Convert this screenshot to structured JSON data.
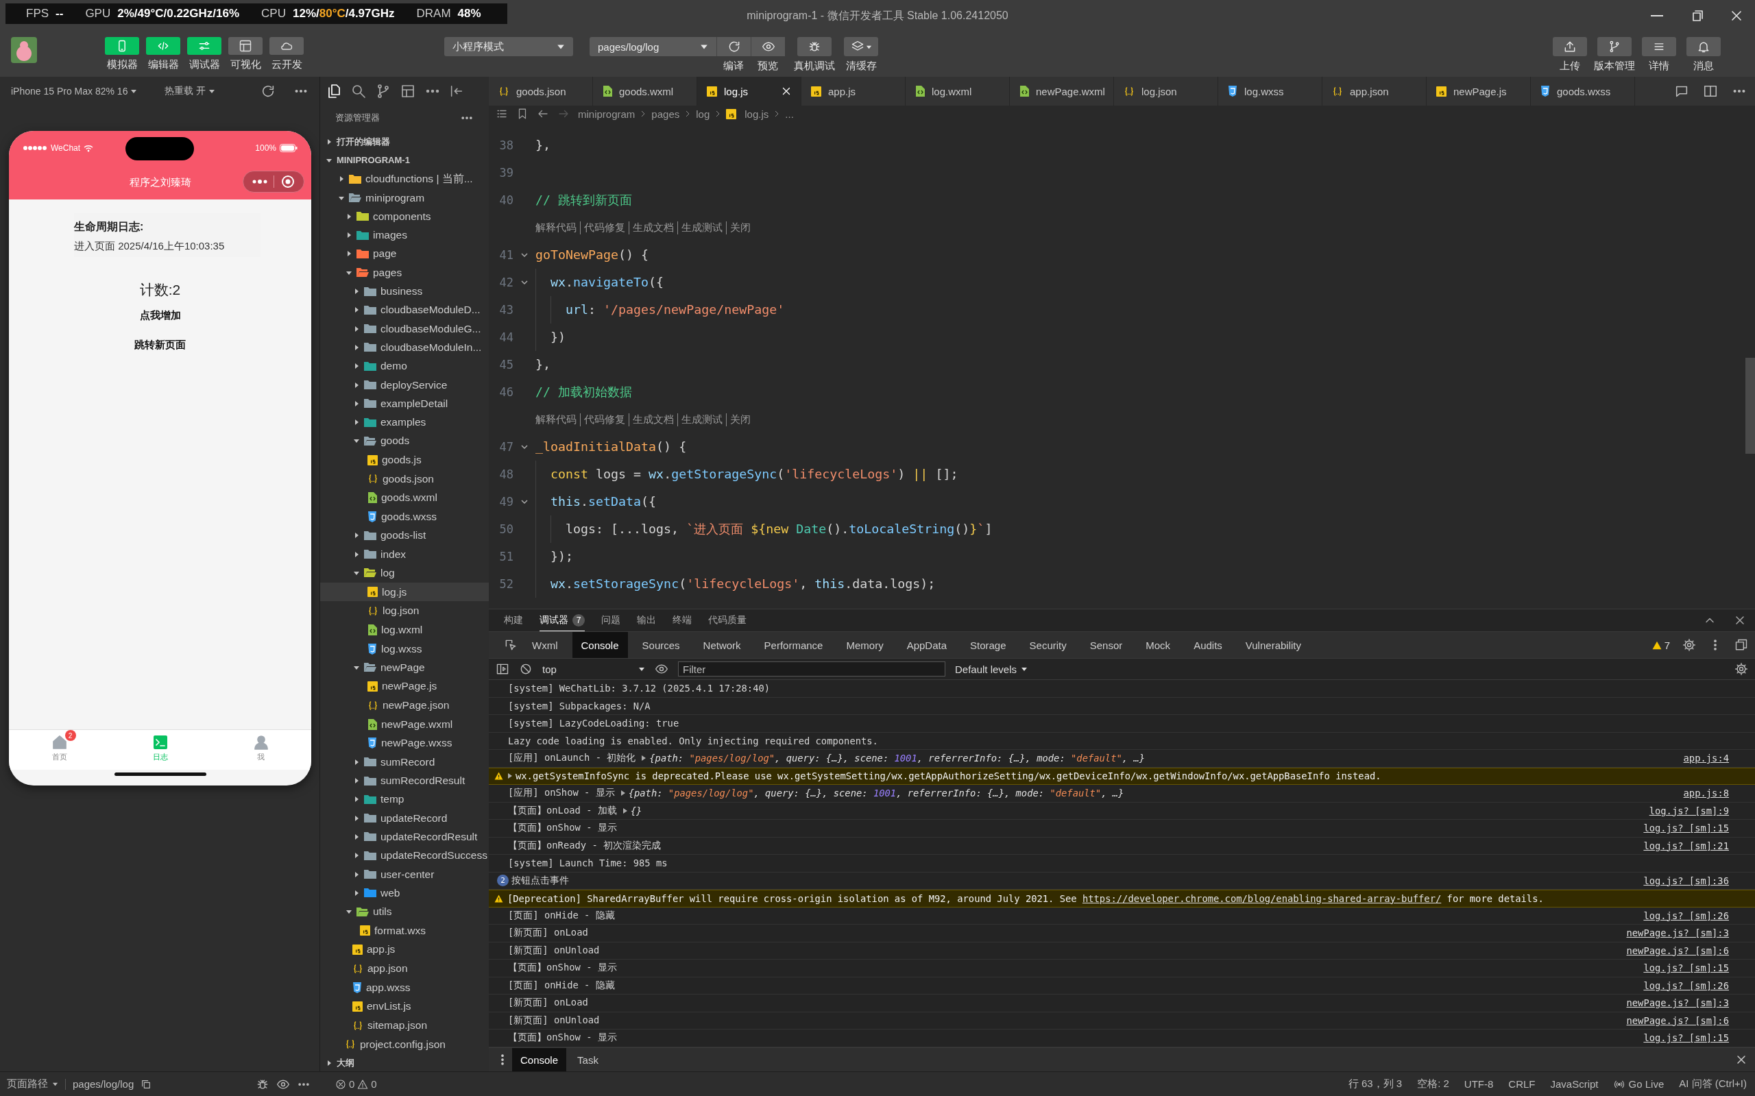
{
  "window": {
    "title": "miniprogram-1 - 微信开发者工具 Stable 1.06.2412050"
  },
  "perf_overlay": [
    {
      "label": "FPS",
      "value": [
        {
          "text": "--",
          "hot": false
        }
      ]
    },
    {
      "label": "GPU",
      "value": [
        {
          "text": "2%/49°C/0.22GHz/16%",
          "hot": false
        }
      ]
    },
    {
      "label": "CPU",
      "value": [
        {
          "text": "12%/",
          "hot": false
        },
        {
          "text": "80°C",
          "hot": true
        },
        {
          "text": "/4.97GHz",
          "hot": false
        }
      ]
    },
    {
      "label": "DRAM",
      "value": [
        {
          "text": "48%",
          "hot": false
        }
      ]
    }
  ],
  "toolbar": {
    "views": [
      {
        "label": "模拟器",
        "kind": "phone",
        "on": true
      },
      {
        "label": "编辑器",
        "kind": "code",
        "on": true
      },
      {
        "label": "调试器",
        "kind": "sliders",
        "on": true
      },
      {
        "label": "可视化",
        "kind": "layout",
        "on": false
      },
      {
        "label": "云开发",
        "kind": "cloud",
        "on": false
      }
    ],
    "mode_select": "小程序模式",
    "page_select": "pages/log/log",
    "actions": [
      {
        "label": "编译",
        "kind": "refresh"
      },
      {
        "label": "预览",
        "kind": "eye"
      },
      {
        "label": "真机调试",
        "kind": "bug"
      },
      {
        "label": "清缓存",
        "kind": "layers"
      }
    ],
    "right_actions": [
      {
        "label": "上传",
        "kind": "upload"
      },
      {
        "label": "版本管理",
        "kind": "branch"
      },
      {
        "label": "详情",
        "kind": "menu"
      },
      {
        "label": "消息",
        "kind": "bell"
      }
    ]
  },
  "simulator": {
    "device": "iPhone 15 Pro Max 82% 16",
    "hot_reload": "热重载 开",
    "phone": {
      "carrier": "WeChat",
      "battery": "100%",
      "nav_title": "程序之刘臻琦",
      "log_title": "生命周期日志:",
      "log_entries": [
        "进入页面 2025/4/16上午10:03:35"
      ],
      "counter": "计数:2",
      "buttons": [
        "点我增加",
        "跳转新页面"
      ],
      "tabs": [
        {
          "label": "首页",
          "kind": "home",
          "selected": false,
          "badge": "2"
        },
        {
          "label": "日志",
          "kind": "terminal",
          "selected": true
        },
        {
          "label": "我",
          "kind": "person",
          "selected": false
        }
      ]
    }
  },
  "explorer": {
    "title": "资源管理器",
    "sections": [
      {
        "label": "打开的编辑器",
        "expanded": false,
        "selected": false
      },
      {
        "label": "MINIPROGRAM-1",
        "expanded": true,
        "selected": false,
        "children": [
          {
            "name": "cloudfunctions | 当前...",
            "kind": "folder",
            "color": "#f5b82e",
            "expanded": false,
            "selected": false
          },
          {
            "name": "miniprogram",
            "kind": "folder",
            "color": "#90a4ae",
            "expanded": true,
            "selected": false,
            "children": [
              {
                "name": "components",
                "kind": "folder",
                "color": "#c0ca33",
                "expanded": false,
                "selected": false
              },
              {
                "name": "images",
                "kind": "folder",
                "color": "#26a69a",
                "expanded": false,
                "selected": false
              },
              {
                "name": "page",
                "kind": "folder",
                "color": "#ff7043",
                "expanded": false,
                "selected": false
              },
              {
                "name": "pages",
                "kind": "folder",
                "color": "#ff7043",
                "expanded": true,
                "selected": false,
                "children": [
                  {
                    "name": "business",
                    "kind": "folder",
                    "color": "#90a4ae",
                    "expanded": false,
                    "selected": false
                  },
                  {
                    "name": "cloudbaseModuleD...",
                    "kind": "folder",
                    "color": "#90a4ae",
                    "expanded": false,
                    "selected": false
                  },
                  {
                    "name": "cloudbaseModuleG...",
                    "kind": "folder",
                    "color": "#90a4ae",
                    "expanded": false,
                    "selected": false
                  },
                  {
                    "name": "cloudbaseModuleIn...",
                    "kind": "folder",
                    "color": "#90a4ae",
                    "expanded": false,
                    "selected": false
                  },
                  {
                    "name": "demo",
                    "kind": "folder",
                    "color": "#26a69a",
                    "expanded": false,
                    "selected": false
                  },
                  {
                    "name": "deployService",
                    "kind": "folder",
                    "color": "#90a4ae",
                    "expanded": false,
                    "selected": false
                  },
                  {
                    "name": "exampleDetail",
                    "kind": "folder",
                    "color": "#90a4ae",
                    "expanded": false,
                    "selected": false
                  },
                  {
                    "name": "examples",
                    "kind": "folder",
                    "color": "#26a69a",
                    "expanded": false,
                    "selected": false
                  },
                  {
                    "name": "goods",
                    "kind": "folder",
                    "color": "#90a4ae",
                    "expanded": true,
                    "selected": false,
                    "children": [
                      {
                        "name": "goods.js",
                        "kind": "js",
                        "selected": false
                      },
                      {
                        "name": "goods.json",
                        "kind": "json",
                        "selected": false
                      },
                      {
                        "name": "goods.wxml",
                        "kind": "wxml",
                        "selected": false
                      },
                      {
                        "name": "goods.wxss",
                        "kind": "wxss",
                        "selected": false
                      }
                    ]
                  },
                  {
                    "name": "goods-list",
                    "kind": "folder",
                    "color": "#90a4ae",
                    "expanded": false,
                    "selected": false
                  },
                  {
                    "name": "index",
                    "kind": "folder",
                    "color": "#90a4ae",
                    "expanded": false,
                    "selected": false
                  },
                  {
                    "name": "log",
                    "kind": "folder",
                    "color": "#c0ca33",
                    "expanded": true,
                    "selected": false,
                    "children": [
                      {
                        "name": "log.js",
                        "kind": "js",
                        "selected": true
                      },
                      {
                        "name": "log.json",
                        "kind": "json",
                        "selected": false
                      },
                      {
                        "name": "log.wxml",
                        "kind": "wxml",
                        "selected": false
                      },
                      {
                        "name": "log.wxss",
                        "kind": "wxss",
                        "selected": false
                      }
                    ]
                  },
                  {
                    "name": "newPage",
                    "kind": "folder",
                    "color": "#90a4ae",
                    "expanded": true,
                    "selected": false,
                    "children": [
                      {
                        "name": "newPage.js",
                        "kind": "js",
                        "selected": false
                      },
                      {
                        "name": "newPage.json",
                        "kind": "json",
                        "selected": false
                      },
                      {
                        "name": "newPage.wxml",
                        "kind": "wxml",
                        "selected": false
                      },
                      {
                        "name": "newPage.wxss",
                        "kind": "wxss",
                        "selected": false
                      }
                    ]
                  },
                  {
                    "name": "sumRecord",
                    "kind": "folder",
                    "color": "#90a4ae",
                    "expanded": false,
                    "selected": false
                  },
                  {
                    "name": "sumRecordResult",
                    "kind": "folder",
                    "color": "#90a4ae",
                    "expanded": false,
                    "selected": false
                  },
                  {
                    "name": "temp",
                    "kind": "folder",
                    "color": "#26a69a",
                    "expanded": false,
                    "selected": false
                  },
                  {
                    "name": "updateRecord",
                    "kind": "folder",
                    "color": "#90a4ae",
                    "expanded": false,
                    "selected": false
                  },
                  {
                    "name": "updateRecordResult",
                    "kind": "folder",
                    "color": "#90a4ae",
                    "expanded": false,
                    "selected": false
                  },
                  {
                    "name": "updateRecordSuccess",
                    "kind": "folder",
                    "color": "#90a4ae",
                    "expanded": false,
                    "selected": false
                  },
                  {
                    "name": "user-center",
                    "kind": "folder",
                    "color": "#90a4ae",
                    "expanded": false,
                    "selected": false
                  },
                  {
                    "name": "web",
                    "kind": "folder",
                    "color": "#2196f3",
                    "expanded": false,
                    "selected": false
                  }
                ]
              },
              {
                "name": "utils",
                "kind": "folder",
                "color": "#8bc34a",
                "expanded": true,
                "selected": false,
                "children": [
                  {
                    "name": "format.wxs",
                    "kind": "js",
                    "selected": false
                  }
                ]
              },
              {
                "name": "app.js",
                "kind": "js",
                "selected": false
              },
              {
                "name": "app.json",
                "kind": "json",
                "selected": false
              },
              {
                "name": "app.wxss",
                "kind": "wxss",
                "selected": false
              },
              {
                "name": "envList.js",
                "kind": "js",
                "selected": false
              },
              {
                "name": "sitemap.json",
                "kind": "json",
                "selected": false
              }
            ]
          },
          {
            "name": "project.config.json",
            "kind": "json",
            "selected": false
          }
        ]
      }
    ],
    "outline": {
      "label": "大纲",
      "expanded": false
    }
  },
  "editor": {
    "tabs": [
      {
        "name": "goods.json",
        "kind": "json",
        "selected": false
      },
      {
        "name": "goods.wxml",
        "kind": "wxml",
        "selected": false
      },
      {
        "name": "log.js",
        "kind": "js",
        "selected": true
      },
      {
        "name": "app.js",
        "kind": "js",
        "selected": false
      },
      {
        "name": "log.wxml",
        "kind": "wxml",
        "selected": false
      },
      {
        "name": "newPage.wxml",
        "kind": "wxml",
        "selected": false
      },
      {
        "name": "log.json",
        "kind": "json",
        "selected": false
      },
      {
        "name": "log.wxss",
        "kind": "wxss",
        "selected": false
      },
      {
        "name": "app.json",
        "kind": "json",
        "selected": false
      },
      {
        "name": "newPage.js",
        "kind": "js",
        "selected": false
      },
      {
        "name": "goods.wxss",
        "kind": "wxss",
        "selected": false
      }
    ],
    "breadcrumb": [
      {
        "text": "miniprogram",
        "kind": "folder"
      },
      {
        "text": "pages",
        "kind": "folder"
      },
      {
        "text": "log",
        "kind": "folder"
      },
      {
        "text": "log.js",
        "kind": "js"
      },
      {
        "text": "...",
        "kind": "more"
      }
    ],
    "lines": [
      {
        "kind": "code",
        "number": "38",
        "fold": false,
        "tokens": [
          {
            "kind": "punct",
            "text": "},"
          }
        ]
      },
      {
        "kind": "code",
        "number": "39",
        "fold": false
      },
      {
        "kind": "code",
        "number": "40",
        "fold": false,
        "tokens": [
          {
            "kind": "comment",
            "text": "// 跳转到新页面"
          }
        ]
      },
      {
        "kind": "lens",
        "actions": [
          "解释代码",
          "代码修复",
          "生成文档",
          "生成测试",
          "关闭"
        ]
      },
      {
        "kind": "code",
        "number": "41",
        "fold": true,
        "tokens": [
          {
            "kind": "def",
            "text": "goToNewPage"
          },
          {
            "kind": "punct",
            "text": "() {"
          }
        ]
      },
      {
        "kind": "code",
        "number": "42",
        "fold": true,
        "tokens": [
          {
            "kind": "var",
            "text": "  wx"
          },
          {
            "kind": "punct",
            "text": "."
          },
          {
            "kind": "call",
            "text": "navigateTo"
          },
          {
            "kind": "punct",
            "text": "({"
          }
        ]
      },
      {
        "kind": "code",
        "number": "43",
        "fold": false,
        "tokens": [
          {
            "kind": "var",
            "text": "    url"
          },
          {
            "kind": "punct",
            "text": ": "
          },
          {
            "kind": "str",
            "text": "'/pages/newPage/newPage'"
          }
        ]
      },
      {
        "kind": "code",
        "number": "44",
        "fold": false,
        "tokens": [
          {
            "kind": "punct",
            "text": "  })"
          }
        ]
      },
      {
        "kind": "code",
        "number": "45",
        "fold": false,
        "tokens": [
          {
            "kind": "punct",
            "text": "},"
          }
        ]
      },
      {
        "kind": "code",
        "number": "46",
        "fold": false,
        "tokens": [
          {
            "kind": "comment",
            "text": "// 加载初始数据"
          }
        ]
      },
      {
        "kind": "lens",
        "actions": [
          "解释代码",
          "代码修复",
          "生成文档",
          "生成测试",
          "关闭"
        ]
      },
      {
        "kind": "code",
        "number": "47",
        "fold": true,
        "tokens": [
          {
            "kind": "def",
            "text": "_loadInitialData"
          },
          {
            "kind": "punct",
            "text": "() {"
          }
        ]
      },
      {
        "kind": "code",
        "number": "48",
        "fold": false,
        "tokens": [
          {
            "kind": "kw",
            "text": "  const"
          },
          {
            "kind": "punct",
            "text": " logs = "
          },
          {
            "kind": "var",
            "text": "wx"
          },
          {
            "kind": "punct",
            "text": "."
          },
          {
            "kind": "call",
            "text": "getStorageSync"
          },
          {
            "kind": "punct",
            "text": "("
          },
          {
            "kind": "str",
            "text": "'lifecycleLogs'"
          },
          {
            "kind": "punct",
            "text": ") "
          },
          {
            "kind": "op",
            "text": "||"
          },
          {
            "kind": "punct",
            "text": " [];"
          }
        ]
      },
      {
        "kind": "code",
        "number": "49",
        "fold": true,
        "tokens": [
          {
            "kind": "var",
            "text": "  this"
          },
          {
            "kind": "punct",
            "text": "."
          },
          {
            "kind": "call",
            "text": "setData"
          },
          {
            "kind": "punct",
            "text": "({"
          }
        ]
      },
      {
        "kind": "code",
        "number": "50",
        "fold": false,
        "tokens": [
          {
            "kind": "punct",
            "text": "    logs: [...logs, "
          },
          {
            "kind": "str",
            "text": "`进入页面 "
          },
          {
            "kind": "kw",
            "text": "${"
          },
          {
            "kind": "kw",
            "text": "new"
          },
          {
            "kind": "cls",
            "text": " Date"
          },
          {
            "kind": "punct",
            "text": "()."
          },
          {
            "kind": "call",
            "text": "toLocaleString"
          },
          {
            "kind": "punct",
            "text": "()"
          },
          {
            "kind": "kw",
            "text": "}"
          },
          {
            "kind": "str",
            "text": "`"
          },
          {
            "kind": "punct",
            "text": "]"
          }
        ]
      },
      {
        "kind": "code",
        "number": "51",
        "fold": false,
        "tokens": [
          {
            "kind": "punct",
            "text": "  });"
          }
        ]
      },
      {
        "kind": "code",
        "number": "52",
        "fold": false,
        "tokens": [
          {
            "kind": "var",
            "text": "  wx"
          },
          {
            "kind": "punct",
            "text": "."
          },
          {
            "kind": "call",
            "text": "setStorageSync"
          },
          {
            "kind": "punct",
            "text": "("
          },
          {
            "kind": "str",
            "text": "'lifecycleLogs'"
          },
          {
            "kind": "punct",
            "text": ", "
          },
          {
            "kind": "var",
            "text": "this"
          },
          {
            "kind": "punct",
            "text": ".data.logs);"
          }
        ]
      }
    ]
  },
  "panel": {
    "tabs": [
      {
        "label": "构建",
        "selected": false
      },
      {
        "label": "调试器",
        "selected": true,
        "badge": "7"
      },
      {
        "label": "问题",
        "selected": false
      },
      {
        "label": "输出",
        "selected": false
      },
      {
        "label": "终端",
        "selected": false
      },
      {
        "label": "代码质量",
        "selected": false
      }
    ],
    "devtools_tabs": [
      {
        "label": "Wxml",
        "selected": false
      },
      {
        "label": "Console",
        "selected": true
      },
      {
        "label": "Sources",
        "selected": false
      },
      {
        "label": "Network",
        "selected": false
      },
      {
        "label": "Performance",
        "selected": false
      },
      {
        "label": "Memory",
        "selected": false
      },
      {
        "label": "AppData",
        "selected": false
      },
      {
        "label": "Storage",
        "selected": false
      },
      {
        "label": "Security",
        "selected": false
      },
      {
        "label": "Sensor",
        "selected": false
      },
      {
        "label": "Mock",
        "selected": false
      },
      {
        "label": "Audits",
        "selected": false
      },
      {
        "label": "Vulnerability",
        "selected": false
      }
    ],
    "warning_count": "7",
    "context": "top",
    "filter_placeholder": "Filter",
    "levels": "Default levels",
    "console": [
      {
        "kind": "log",
        "parts": [
          {
            "kind": "text",
            "text": "[system] WeChatLib: 3.7.12 (2025.4.1 17:28:40)"
          }
        ]
      },
      {
        "kind": "log",
        "parts": [
          {
            "kind": "text",
            "text": "[system] Subpackages: N/A"
          }
        ]
      },
      {
        "kind": "log",
        "parts": [
          {
            "kind": "text",
            "text": "[system] LazyCodeLoading: true"
          }
        ]
      },
      {
        "kind": "log",
        "parts": [
          {
            "kind": "text",
            "text": "Lazy code loading is enabled. Only injecting required components."
          }
        ]
      },
      {
        "kind": "log",
        "source": "app.js:4",
        "parts": [
          {
            "kind": "text",
            "text": "[应用] onLaunch - 初始化"
          },
          {
            "kind": "toggle"
          },
          {
            "kind": "preview",
            "tokens": [
              {
                "kind": "obj",
                "text": "{path: "
              },
              {
                "kind": "str",
                "text": "\"pages/log/log\""
              },
              {
                "kind": "obj",
                "text": ", query: {…}, scene: "
              },
              {
                "kind": "num",
                "text": "1001"
              },
              {
                "kind": "obj",
                "text": ", referrerInfo: {…}, mode: "
              },
              {
                "kind": "str",
                "text": "\"default\""
              },
              {
                "kind": "obj",
                "text": ", …}"
              }
            ]
          }
        ]
      },
      {
        "kind": "warn",
        "parts": [
          {
            "kind": "toggle"
          },
          {
            "kind": "text",
            "text": "wx.getSystemInfoSync is deprecated.Please use wx.getSystemSetting/wx.getAppAuthorizeSetting/wx.getDeviceInfo/wx.getWindowInfo/wx.getAppBaseInfo instead."
          }
        ]
      },
      {
        "kind": "log",
        "source": "app.js:8",
        "parts": [
          {
            "kind": "text",
            "text": "[应用] onShow - 显示"
          },
          {
            "kind": "toggle"
          },
          {
            "kind": "preview",
            "tokens": [
              {
                "kind": "obj",
                "text": "{path: "
              },
              {
                "kind": "str",
                "text": "\"pages/log/log\""
              },
              {
                "kind": "obj",
                "text": ", query: {…}, scene: "
              },
              {
                "kind": "num",
                "text": "1001"
              },
              {
                "kind": "obj",
                "text": ", referrerInfo: {…}, mode: "
              },
              {
                "kind": "str",
                "text": "\"default\""
              },
              {
                "kind": "obj",
                "text": ", …}"
              }
            ]
          }
        ]
      },
      {
        "kind": "log",
        "source": "log.js? [sm]:9",
        "parts": [
          {
            "kind": "text",
            "text": "【页面】onLoad - 加载"
          },
          {
            "kind": "toggle"
          },
          {
            "kind": "preview",
            "tokens": [
              {
                "kind": "obj",
                "text": "{}"
              }
            ]
          }
        ]
      },
      {
        "kind": "log",
        "source": "log.js? [sm]:15",
        "parts": [
          {
            "kind": "text",
            "text": "【页面】onShow - 显示"
          }
        ]
      },
      {
        "kind": "log",
        "source": "log.js? [sm]:21",
        "parts": [
          {
            "kind": "text",
            "text": "【页面】onReady - 初次渲染完成"
          }
        ]
      },
      {
        "kind": "log",
        "parts": [
          {
            "kind": "text",
            "text": "[system] Launch Time: 985 ms"
          }
        ]
      },
      {
        "kind": "log",
        "count": "2",
        "source": "log.js? [sm]:36",
        "parts": [
          {
            "kind": "text",
            "text": "按钮点击事件"
          }
        ]
      },
      {
        "kind": "warn",
        "parts": [
          {
            "kind": "sentence",
            "before": "[Deprecation] SharedArrayBuffer will require cross-origin isolation as of M92, around July 2021. See ",
            "link": "https://developer.chrome.com/blog/enabling-shared-array-buffer/",
            "after": " for more details."
          }
        ]
      },
      {
        "kind": "log",
        "source": "log.js? [sm]:26",
        "parts": [
          {
            "kind": "text",
            "text": "[页面] onHide - 隐藏"
          }
        ]
      },
      {
        "kind": "log",
        "source": "newPage.js? [sm]:3",
        "parts": [
          {
            "kind": "text",
            "text": "[新页面] onLoad"
          }
        ]
      },
      {
        "kind": "log",
        "source": "newPage.js? [sm]:6",
        "parts": [
          {
            "kind": "text",
            "text": "[新页面] onUnload"
          }
        ]
      },
      {
        "kind": "log",
        "source": "log.js? [sm]:15",
        "parts": [
          {
            "kind": "text",
            "text": "【页面】onShow - 显示"
          }
        ]
      },
      {
        "kind": "log",
        "source": "log.js? [sm]:26",
        "parts": [
          {
            "kind": "text",
            "text": "[页面] onHide - 隐藏"
          }
        ]
      },
      {
        "kind": "log",
        "source": "newPage.js? [sm]:3",
        "parts": [
          {
            "kind": "text",
            "text": "[新页面] onLoad"
          }
        ]
      },
      {
        "kind": "log",
        "source": "newPage.js? [sm]:6",
        "parts": [
          {
            "kind": "text",
            "text": "[新页面] onUnload"
          }
        ]
      },
      {
        "kind": "log",
        "source": "log.js? [sm]:15",
        "parts": [
          {
            "kind": "text",
            "text": "【页面】onShow - 显示"
          }
        ]
      }
    ],
    "drawer_tabs": [
      {
        "label": "Console",
        "selected": true
      },
      {
        "label": "Task",
        "selected": false
      }
    ]
  },
  "status_bar": {
    "page_path_label": "页面路径",
    "page_path": "pages/log/log",
    "errors": "0",
    "warnings": "0",
    "items": [
      {
        "text": "行 63，列 3",
        "kind": "text"
      },
      {
        "text": "空格: 2",
        "kind": "text"
      },
      {
        "text": "UTF-8",
        "kind": "text"
      },
      {
        "text": "CRLF",
        "kind": "text"
      },
      {
        "text": "JavaScript",
        "kind": "text"
      },
      {
        "text": "Go Live",
        "kind": "live"
      },
      {
        "text": "AI 问答 (Ctrl+I)",
        "kind": "text"
      }
    ]
  }
}
